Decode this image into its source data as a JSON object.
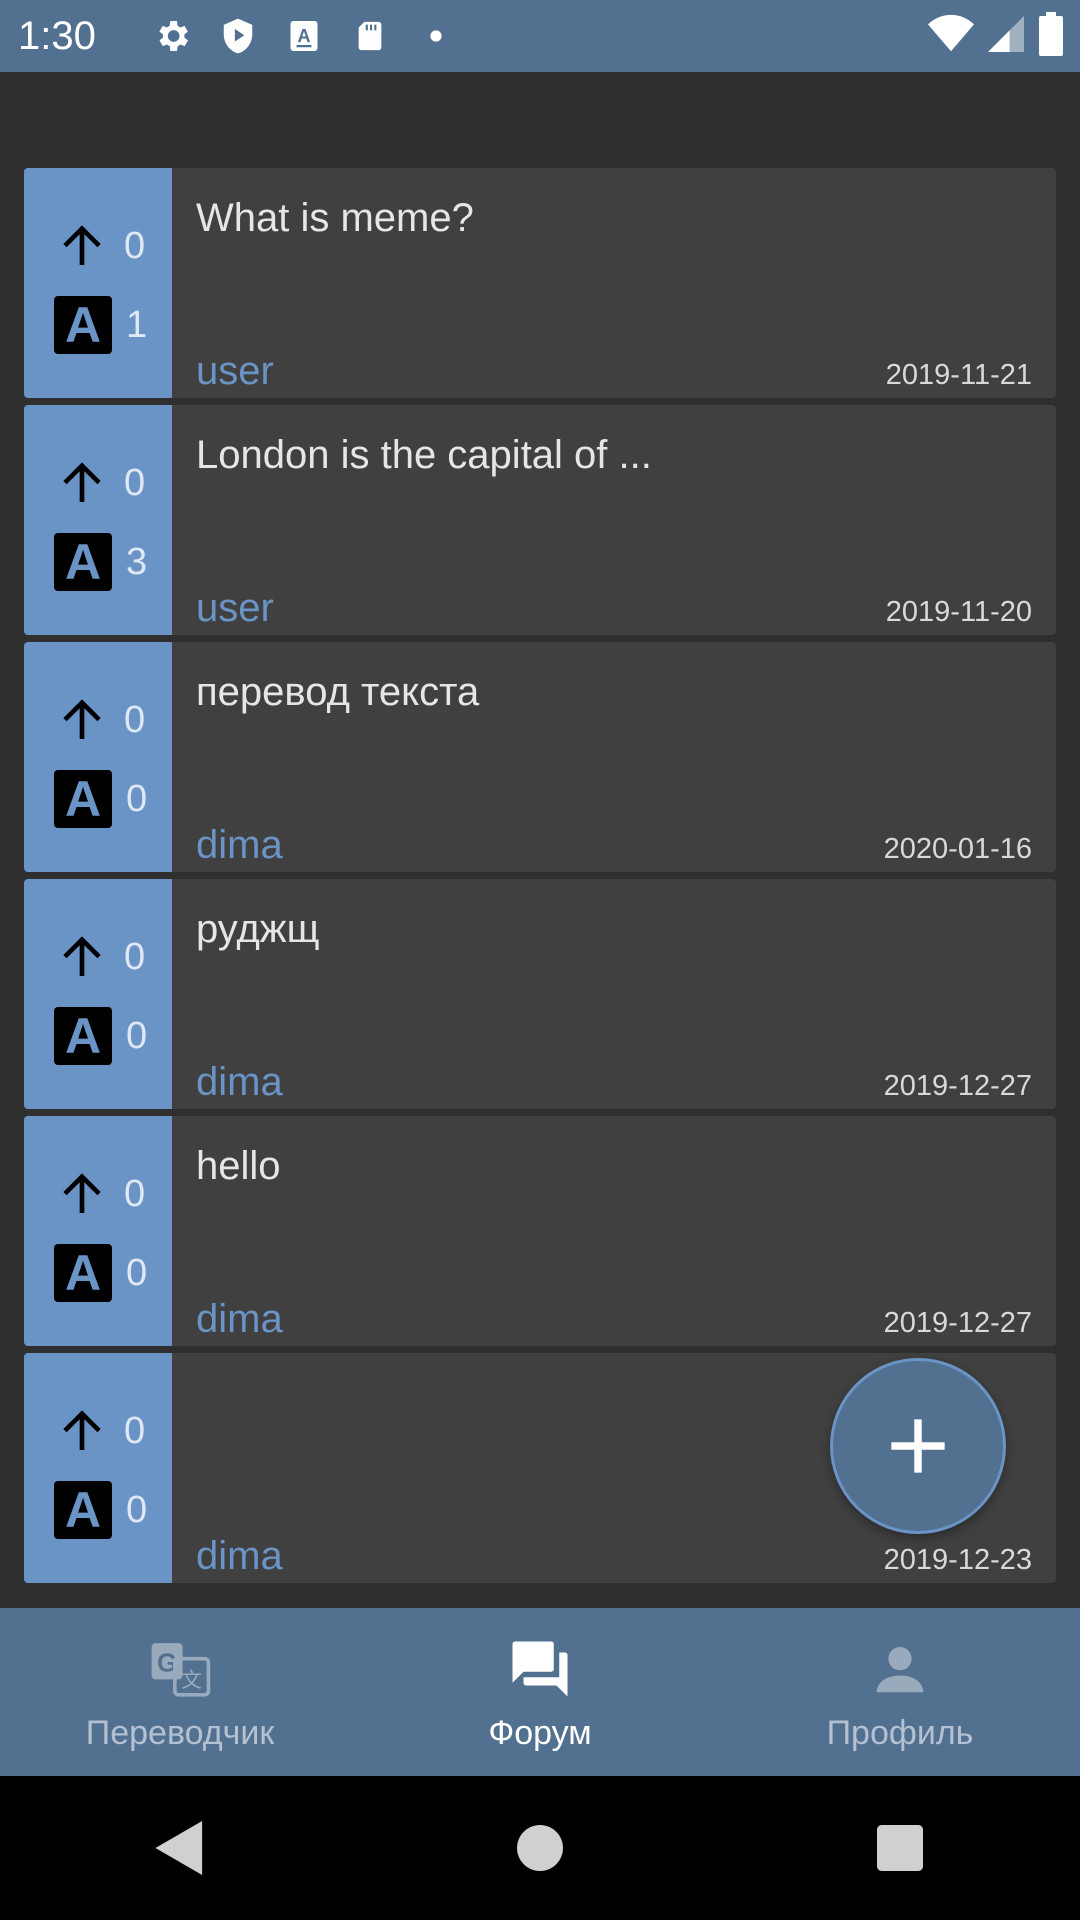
{
  "status": {
    "time": "1:30",
    "icons": [
      "settings-icon",
      "shield-play-icon",
      "font-a-icon",
      "sd-card-icon",
      "dot-icon",
      "wifi-icon",
      "signal-icon",
      "battery-icon"
    ]
  },
  "posts": [
    {
      "title": "What is meme?",
      "user": "user",
      "date": "2019-11-21",
      "votes": "0",
      "answers": "1"
    },
    {
      "title": "London is the capital of ...",
      "user": "user",
      "date": "2019-11-20",
      "votes": "0",
      "answers": "3"
    },
    {
      "title": "перевод текста",
      "user": "dima",
      "date": "2020-01-16",
      "votes": "0",
      "answers": "0"
    },
    {
      "title": "руджщ",
      "user": "dima",
      "date": "2019-12-27",
      "votes": "0",
      "answers": "0"
    },
    {
      "title": "hello",
      "user": "dima",
      "date": "2019-12-27",
      "votes": "0",
      "answers": "0"
    },
    {
      "title": "",
      "user": "dima",
      "date": "2019-12-23",
      "votes": "0",
      "answers": "0"
    }
  ],
  "answer_badge": "A",
  "nav": {
    "translator": "Переводчик",
    "forum": "Форум",
    "profile": "Профиль"
  },
  "colors": {
    "accent": "#6a93c6",
    "bar": "#52708f",
    "card": "#404040",
    "background": "#2f2f2f"
  }
}
